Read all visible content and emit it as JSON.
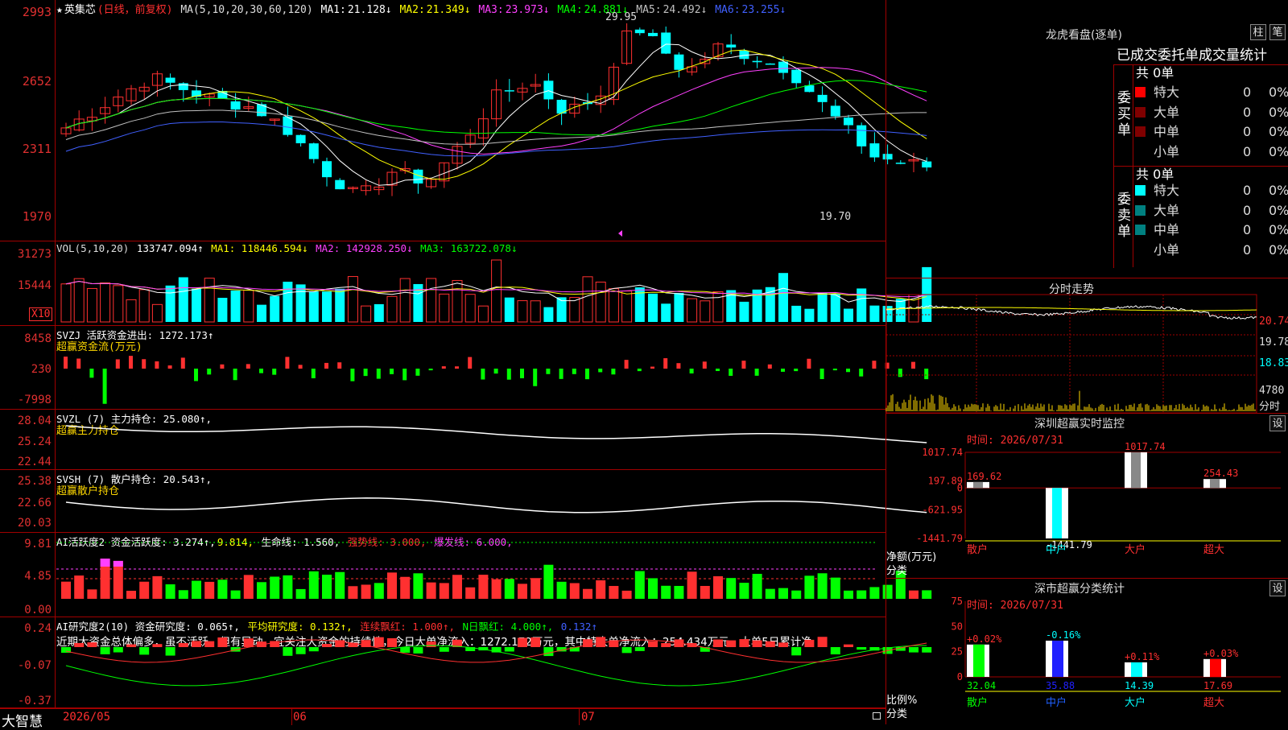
{
  "app": {
    "logo": "大智慧"
  },
  "colors": {
    "up": "#ff3030",
    "down": "#00ffff",
    "ma1": "#ffffff",
    "ma2": "#ffff00",
    "ma3": "#ff40ff",
    "ma4": "#00ff00",
    "ma5": "#c0c0c0",
    "ma6": "#4060ff"
  },
  "main": {
    "star": "★",
    "name": "英集芯",
    "mode": "(日线，前复权)",
    "ma_def": "MA(5,10,20,30,60,120)",
    "ma": [
      {
        "label": "MA1:",
        "value": "21.128↓"
      },
      {
        "label": "MA2:",
        "value": "21.349↓"
      },
      {
        "label": "MA3:",
        "value": "23.973↓"
      },
      {
        "label": "MA4:",
        "value": "24.881↓"
      },
      {
        "label": "MA5:",
        "value": "24.492↓"
      },
      {
        "label": "MA6:",
        "value": "23.255↓"
      }
    ],
    "y_labels": [
      "2993",
      "2652",
      "2311",
      "1970"
    ],
    "high_mark": "29.95",
    "low_mark": "19.70"
  },
  "vol": {
    "title": "VOL(5,10,20)",
    "value": "133747.094↑",
    "ma1": "MA1: 118446.594↓",
    "ma2": "MA2: 142928.250↓",
    "ma3": "MA3: 163722.078↓",
    "y_labels": [
      "31273",
      "15444"
    ],
    "unit": "X10"
  },
  "svzj": {
    "title": "SVZJ  活跃资金进出: 1272.173↑",
    "sub": "超赢资金流(万元)",
    "y_labels": [
      "8458",
      "230",
      "-7998"
    ]
  },
  "svzl": {
    "title": "SVZL (7) 主力持仓: 25.080↑,",
    "sub": "超赢主力持仓",
    "y_labels": [
      "28.04",
      "25.24",
      "22.44"
    ]
  },
  "svsh": {
    "title": "SVSH (7) 散户持仓: 20.543↑,",
    "sub": "超赢散户持仓",
    "y_labels": [
      "25.38",
      "22.66",
      "20.03"
    ]
  },
  "ai_active": {
    "t1": "AI活跃度2 资金活跃度: 3.274↑,",
    "t2": "9.814,",
    "t3": "生命线: 1.560,",
    "t4": "强势线: 3.000,",
    "t5": "爆发线: 6.000,",
    "y_labels": [
      "9.81",
      "4.85",
      "0.00"
    ]
  },
  "ai_research": {
    "t1": "AI研究度2(10) 资金研究度: 0.065↑,",
    "t2": "平均研究度: 0.132↑,",
    "t3": "连续飘红: 1.000↑,",
    "t4": "N日飘红: 4.000↑,",
    "t5": "0.132↑",
    "text": "近期大资金总体偏多，虽不活跃，但有异动，宜关注大资金的持续性，今日大单净流入：1272.172万元，其中特大单净流入：254.434万元，大单5日累计净",
    "y_labels": [
      "0.24",
      "-0.07",
      "-0.37"
    ]
  },
  "dates": [
    "2026/05",
    "06",
    "07"
  ],
  "dragon": {
    "title": "龙虎看盘(逐单)",
    "btn1": "柱",
    "btn2": "笔",
    "header": "已成交委托单成交量统计",
    "buy_label": "委买单",
    "sell_label": "委卖单",
    "buy_total": "共 0单",
    "sell_total": "共 0单",
    "buy_rows": [
      {
        "name": "特大",
        "n": "0",
        "p": "0%",
        "c": "#ff0000"
      },
      {
        "name": "大单",
        "n": "0",
        "p": "0%",
        "c": "#800000"
      },
      {
        "name": "中单",
        "n": "0",
        "p": "0%",
        "c": "#800000"
      },
      {
        "name": "小单",
        "n": "0",
        "p": "0%",
        "c": "#000000"
      }
    ],
    "sell_rows": [
      {
        "name": "特大",
        "n": "0",
        "p": "0%",
        "c": "#00ffff"
      },
      {
        "name": "大单",
        "n": "0",
        "p": "0%",
        "c": "#008080"
      },
      {
        "name": "中单",
        "n": "0",
        "p": "0%",
        "c": "#008080"
      },
      {
        "name": "小单",
        "n": "0",
        "p": "0%",
        "c": "#000000"
      }
    ]
  },
  "intraday": {
    "title": "分时走势",
    "y_labels": [
      "20.74",
      "19.78",
      "18.83"
    ],
    "vol_label": "4780",
    "vol_unit": "分时"
  },
  "monitor": {
    "title": "深圳超赢实时监控",
    "btn": "设",
    "time": "时间: 2026/07/31",
    "y_labels": [
      "1017.74",
      "197.89",
      "0",
      "-621.95",
      "-1441.79"
    ],
    "unit": "净额(万元)",
    "cat_label": "分类",
    "bars": [
      {
        "name": "散户",
        "value": 169.62,
        "label": "169.62",
        "c": "#ffffff"
      },
      {
        "name": "中户",
        "value": -1441.79,
        "label": "-1441.79",
        "c": "#00ffff"
      },
      {
        "name": "大户",
        "value": 1017.74,
        "label": "1017.74",
        "c": "#ffffff"
      },
      {
        "name": "超大",
        "value": 254.43,
        "label": "254.43",
        "c": "#ffffff"
      }
    ]
  },
  "classify": {
    "title": "深市超赢分类统计",
    "btn": "设",
    "time": "时间: 2026/07/31",
    "y_labels": [
      "75",
      "50",
      "25",
      "0"
    ],
    "unit": "比例%",
    "cat_label": "分类",
    "bars": [
      {
        "name": "散户",
        "value": 32.04,
        "label": "32.04",
        "chg": "+0.02%",
        "c": "#00ff00"
      },
      {
        "name": "中户",
        "value": 35.88,
        "label": "35.88",
        "chg": "-0.16%",
        "c": "#2020ff"
      },
      {
        "name": "大户",
        "value": 14.39,
        "label": "14.39",
        "chg": "+0.11%",
        "c": "#00ffff"
      },
      {
        "name": "超大",
        "value": 17.69,
        "label": "17.69",
        "chg": "+0.03%",
        "c": "#ff0000"
      }
    ]
  }
}
